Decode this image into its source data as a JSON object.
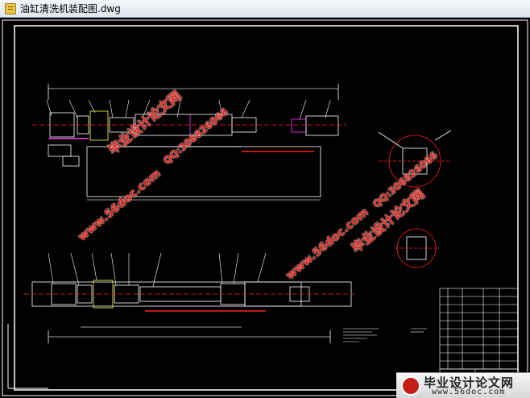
{
  "window": {
    "title": "油缸清洗机装配图.dwg",
    "icon": "dwg-file-icon"
  },
  "watermarks": {
    "brand": "毕业设计论文网",
    "qq": "QQ:306826066",
    "url": "www.56doc.com"
  },
  "logo": {
    "title": "毕业设计论文网",
    "url": "www.56doc.com"
  },
  "colors": {
    "background": "#000000",
    "line_white": "#ffffff",
    "line_red": "#ff2020",
    "line_magenta": "#ff40ff",
    "line_yellow": "#ffff40",
    "line_cyan": "#40ffff",
    "watermark_red": "#e0231b"
  }
}
